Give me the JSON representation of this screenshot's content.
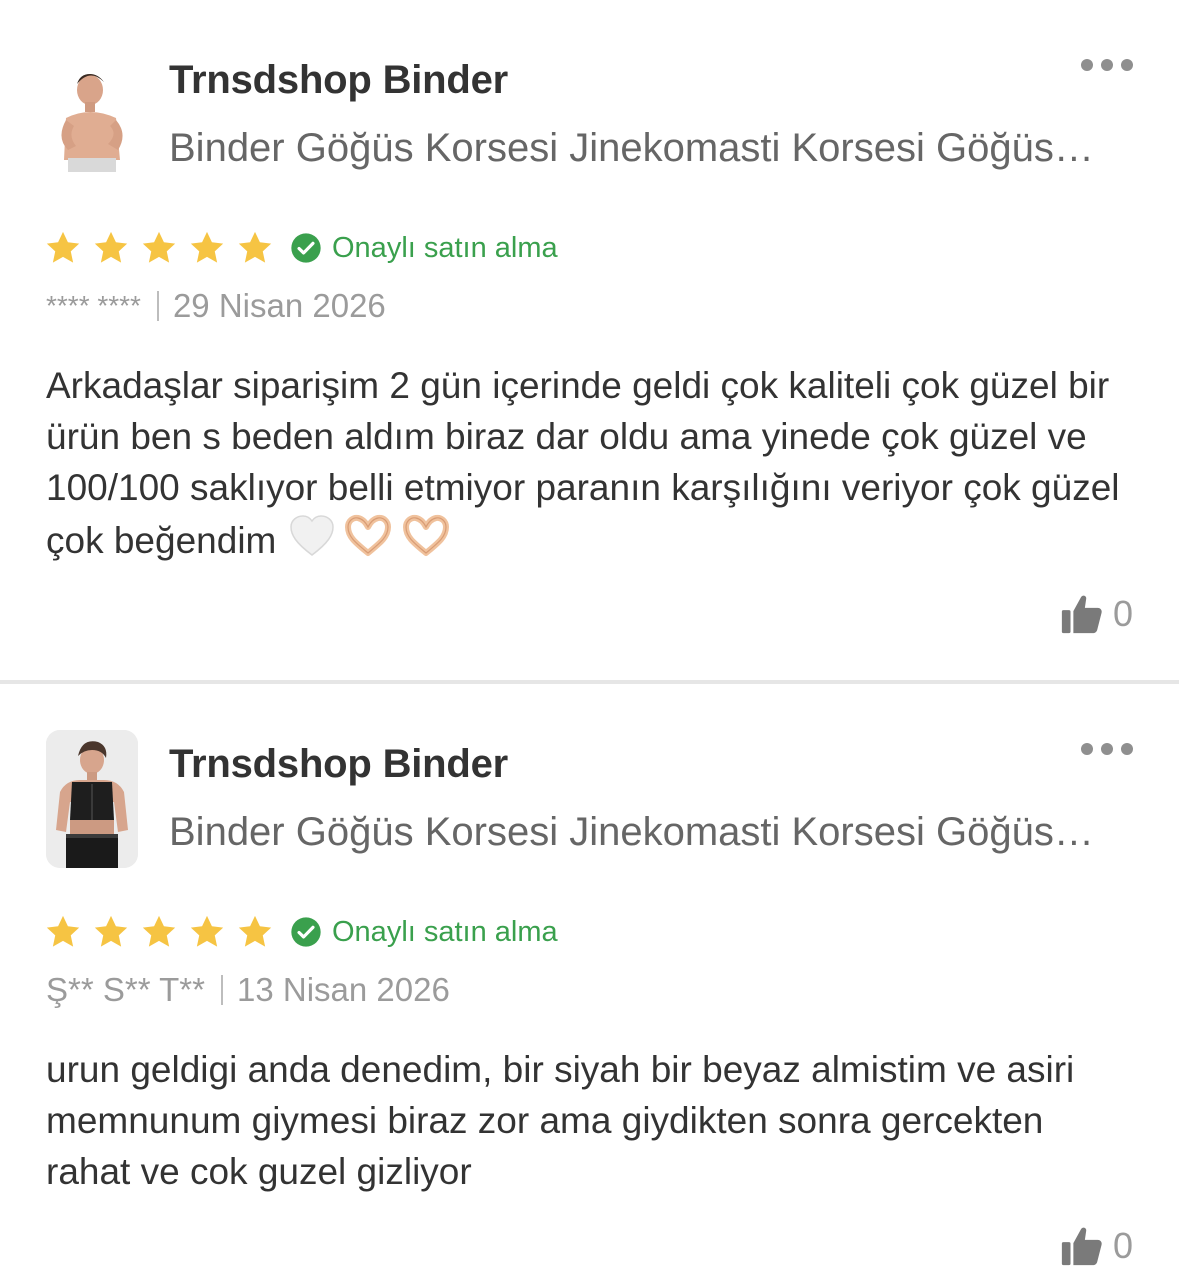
{
  "reviews": [
    {
      "product_name": "Trnsdshop Binder",
      "product_description": "Binder Göğüs Korsesi Jinekomasti Korsesi Göğüs Düzleştirici",
      "rating": 5,
      "verified_label": "Onaylı satın alma",
      "reviewer": "**** ****",
      "date": "29 Nisan 2026",
      "text": "Arkadaşlar siparişim 2 gün içerinde geldi çok kaliteli çok güzel bir ürün ben s beden aldım biraz dar oldu ama yinede çok güzel ve 100/100 saklıyor belli etmiyor paranın karşılığını veriyor çok güzel çok beğendim",
      "emojis": [
        "white-heart",
        "heart-hands",
        "heart-hands"
      ],
      "like_count": "0"
    },
    {
      "product_name": "Trnsdshop Binder",
      "product_description": "Binder Göğüs Korsesi Jinekomasti Korsesi Göğüs Düzleştirici",
      "rating": 5,
      "verified_label": "Onaylı satın alma",
      "reviewer": "Ş** S** T**",
      "date": "13 Nisan 2026",
      "text": "urun geldigi anda denedim, bir siyah bir beyaz almistim ve asiri memnunum giymesi biraz zor ama giydikten sonra gercekten rahat ve cok guzel gizliyor",
      "like_count": "0"
    }
  ],
  "colors": {
    "star": "#f6c443",
    "verified": "#3aa04d",
    "muted": "#9b9b9b",
    "text": "#333333"
  },
  "icons": {
    "more": "more-dots-icon",
    "star": "star-icon",
    "verified": "check-circle-icon",
    "like": "thumbs-up-icon"
  }
}
